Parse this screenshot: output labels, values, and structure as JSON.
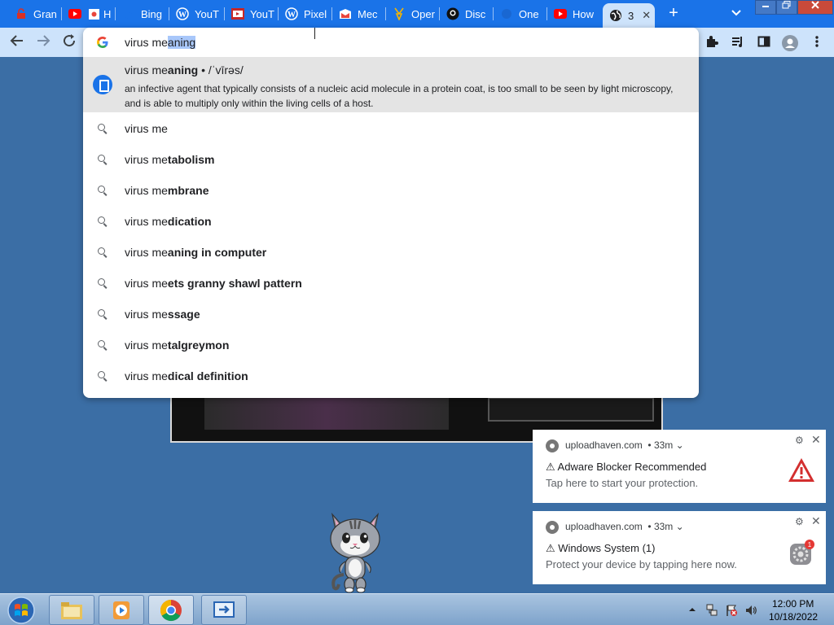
{
  "tabs": [
    {
      "label": "Gran",
      "icon": "lock-icon",
      "color": "#d93025"
    },
    {
      "label": "H",
      "icon": "youtube-icon",
      "color": "#ff0000"
    },
    {
      "label": "Bing",
      "icon": "bing-icon",
      "color": "#1a73e8"
    },
    {
      "label": "YouT",
      "icon": "wordpress-icon",
      "color": "#ffffff"
    },
    {
      "label": "YouT",
      "icon": "youtube-news-icon",
      "color": "#ff0000"
    },
    {
      "label": "Pixel",
      "icon": "wordpress-icon",
      "color": "#ffffff"
    },
    {
      "label": "Mec",
      "icon": "app-icon",
      "color": "#e8453c"
    },
    {
      "label": "Oper",
      "icon": "badge-icon",
      "color": "#f4b400"
    },
    {
      "label": "Disc",
      "icon": "github-icon",
      "color": "#000000"
    },
    {
      "label": "One",
      "icon": "blank-icon",
      "color": "#1a73e8"
    },
    {
      "label": "How",
      "icon": "youtube-icon",
      "color": "#ff0000"
    },
    {
      "label": "3",
      "icon": "globe-icon",
      "color": "#202124",
      "active": true
    }
  ],
  "omnibox": {
    "typed": "virus me",
    "autocomplete": "aning",
    "definition": {
      "head_typed": "virus me",
      "head_rest": "aning",
      "pronunciation": " • /ˈvīrəs/",
      "text": "an infective agent that typically consists of a nucleic acid molecule in a protein coat, is too small to be seen by light microscopy, and is able to multiply only within the living cells of a host."
    },
    "suggestions": [
      {
        "typed": "virus me",
        "rest": ""
      },
      {
        "typed": "virus me",
        "rest": "tabolism"
      },
      {
        "typed": "virus me",
        "rest": "mbrane"
      },
      {
        "typed": "virus me",
        "rest": "dication"
      },
      {
        "typed": "virus me",
        "rest": "aning in computer"
      },
      {
        "typed": "virus me",
        "rest": "ets granny shawl pattern"
      },
      {
        "typed": "virus me",
        "rest": "ssage"
      },
      {
        "typed": "virus me",
        "rest": "talgreymon"
      },
      {
        "typed": "virus me",
        "rest": "dical definition"
      }
    ]
  },
  "notifications": [
    {
      "source": "uploadhaven.com",
      "time": "• 33m",
      "title": "⚠ Adware Blocker Recommended",
      "body": "Tap here to start your protection.",
      "image": "warning-icon"
    },
    {
      "source": "uploadhaven.com",
      "time": "• 33m",
      "title": "⚠ Windows System (1)",
      "body": "Protect your device by tapping here now.",
      "image": "settings-badge-icon",
      "badge": "1"
    }
  ],
  "taskbar": {
    "time": "12:00 PM",
    "date": "10/18/2022"
  },
  "colors": {
    "tabstrip": "#1a73e8",
    "toolbar": "#cde3fb",
    "desktop": "#3b6ea5",
    "highlight": "#a8c7fa"
  }
}
